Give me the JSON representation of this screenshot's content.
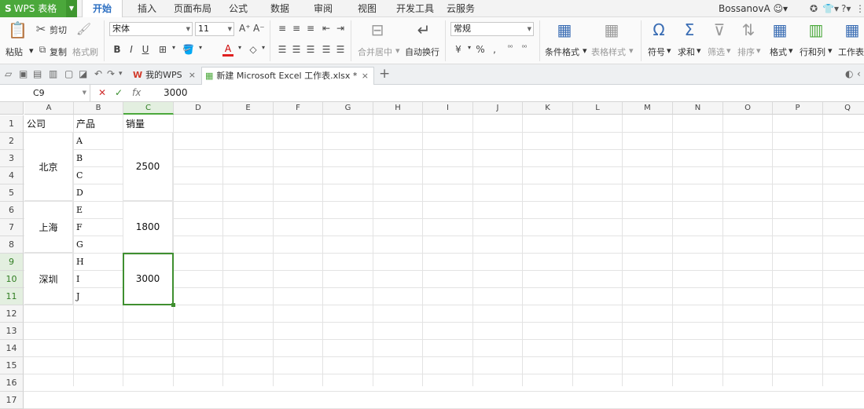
{
  "app": {
    "logo": "S",
    "name": "WPS 表格"
  },
  "menu_tabs": [
    "开始",
    "插入",
    "页面布局",
    "公式",
    "数据",
    "审阅",
    "视图",
    "开发工具",
    "云服务"
  ],
  "user": {
    "name": "BossanovA"
  },
  "ribbon": {
    "paste": "粘贴",
    "cut": "剪切",
    "copy": "复制",
    "format_painter": "格式刷",
    "font_name": "宋体",
    "font_size": "11",
    "merge_center": "合并居中",
    "wrap_text": "自动换行",
    "number_format": "常规",
    "conditional_format": "条件格式",
    "table_style": "表格样式",
    "symbol": "符号",
    "sum": "求和",
    "filter": "筛选",
    "sort": "排序",
    "format": "格式",
    "row_col": "行和列",
    "worksheet": "工作表"
  },
  "doc_tabs": [
    {
      "label": "我的WPS"
    },
    {
      "label": "新建 Microsoft Excel 工作表.xlsx *"
    }
  ],
  "formula_bar": {
    "name_box": "C9",
    "fx": "fx",
    "value": "3000"
  },
  "columns": [
    "A",
    "B",
    "C",
    "D",
    "E",
    "F",
    "G",
    "H",
    "I",
    "J",
    "K",
    "L",
    "M",
    "N",
    "O",
    "P",
    "Q"
  ],
  "rows": [
    "1",
    "2",
    "3",
    "4",
    "5",
    "6",
    "7",
    "8",
    "9",
    "10",
    "11",
    "12",
    "13",
    "14",
    "15",
    "16",
    "17"
  ],
  "sheet": {
    "header": {
      "company": "公司",
      "product": "产品",
      "sales": "销量"
    },
    "groups": [
      {
        "company": "北京",
        "products": [
          "A",
          "B",
          "C",
          "D"
        ],
        "sales": "2500"
      },
      {
        "company": "上海",
        "products": [
          "E",
          "F",
          "G"
        ],
        "sales": "1800"
      },
      {
        "company": "深圳",
        "products": [
          "H",
          "I",
          "J"
        ],
        "sales": "3000"
      }
    ]
  },
  "selected_cell": "C9"
}
